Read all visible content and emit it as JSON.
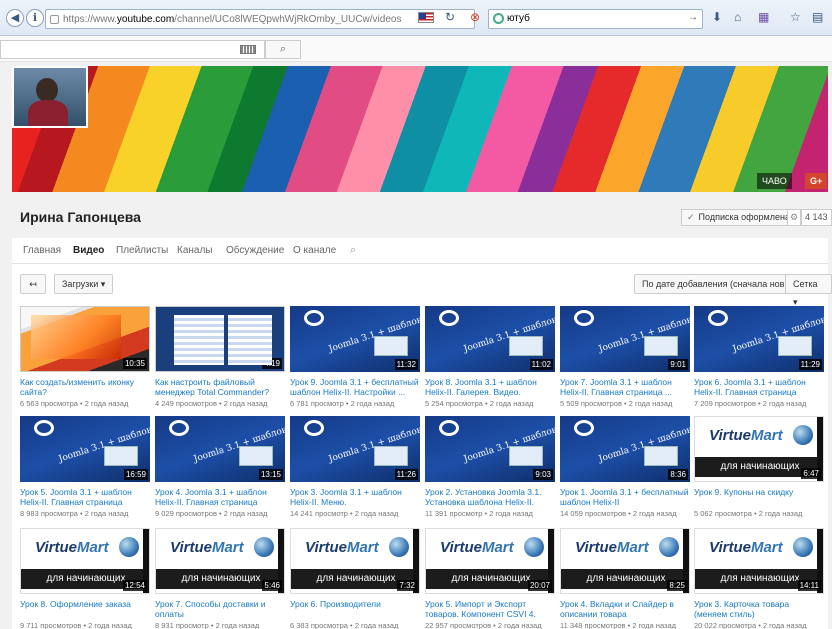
{
  "browser": {
    "url_prefix": "https://www.",
    "url_host": "youtube.com",
    "url_path": "/channel/UCo8lWEQpwhWjRkOmby_UUCw/videos",
    "search_query": "ютуб"
  },
  "channel": {
    "name": "Ирина Гапонцева",
    "subscribe_label": "Подписка оформлена",
    "subscriber_count": "4 143",
    "banner_links": [
      "ЧАВО",
      "G+"
    ]
  },
  "tabs": [
    "Главная",
    "Видео",
    "Плейлисты",
    "Каналы",
    "Обсуждение",
    "О канале"
  ],
  "active_tab": "Видео",
  "toolbar": {
    "uploads_label": "Загрузки ▾",
    "sort_label": "По дате добавления (сначала новые) ▾",
    "grid_label": "Сетка ▾"
  },
  "videos": [
    {
      "title": "Как создать/изменить иконку сайта?",
      "meta": "6 563 просмотра • 2 года назад",
      "duration": "10:35",
      "thumb": "screen1"
    },
    {
      "title": "Как настроить файловый менеджер Total Commander?",
      "meta": "4 249 просмотров • 2 года назад",
      "duration": "4:19",
      "thumb": "screen2"
    },
    {
      "title": "Урок 9. Joomla 3.1 + бесплатный шаблон Helix-II. Настройки ...",
      "meta": "6 781 просмотр • 2 года назад",
      "duration": "11:32",
      "thumb": "joomla"
    },
    {
      "title": "Урок 8. Joomla 3.1 + шаблон Helix-II. Галерея. Видео.",
      "meta": "5 254 просмотра • 2 года назад",
      "duration": "11:02",
      "thumb": "joomla"
    },
    {
      "title": "Урок 7. Joomla 3.1 + шаблон Helix-II. Главная страница ...",
      "meta": "5 509 просмотров • 2 года назад",
      "duration": "9:01",
      "thumb": "joomla"
    },
    {
      "title": "Урок 6. Joomla 3.1 + шаблон Helix-II. Главная страница",
      "meta": "7 209 просмотров • 2 года назад",
      "duration": "11:29",
      "thumb": "joomla"
    },
    {
      "title": "Урок 5. Joomla 3.1 + шаблон Helix-II. Главная страница",
      "meta": "8 983 просмотра • 2 года назад",
      "duration": "16:59",
      "thumb": "joomla"
    },
    {
      "title": "Урок 4. Joomla 3.1 + шаблон Helix-II. Главная страница",
      "meta": "9 029 просмотров • 2 года назад",
      "duration": "13:15",
      "thumb": "joomla"
    },
    {
      "title": "Урок 3. Joomla 3.1 + шаблон Helix-II. Меню.",
      "meta": "14 241 просмотр • 2 года назад",
      "duration": "11:26",
      "thumb": "joomla"
    },
    {
      "title": "Урок 2. Установка Joomla 3.1. Установка шаблона Helix-II.",
      "meta": "11 391 просмотр • 2 года назад",
      "duration": "9:03",
      "thumb": "joomla"
    },
    {
      "title": "Урок 1. Joomla 3.1 + бесплатный шаблон Helix-II",
      "meta": "14 059 просмотров • 2 года назад",
      "duration": "8:36",
      "thumb": "joomla"
    },
    {
      "title": "Урок 9. Купоны на скидку",
      "meta": "5 062 просмотра • 2 года назад",
      "duration": "6:47",
      "thumb": "vm"
    },
    {
      "title": "Урок 8. Оформление заказа",
      "meta": "9 711 просмотров • 2 года назад",
      "duration": "12:54",
      "thumb": "vm"
    },
    {
      "title": "Урок 7. Способы доставки и оплаты",
      "meta": "8 931 просмотр • 2 года назад",
      "duration": "5:46",
      "thumb": "vm"
    },
    {
      "title": "Урок 6. Производители",
      "meta": "6 383 просмотра • 2 года назад",
      "duration": "7:32",
      "thumb": "vm"
    },
    {
      "title": "Урок 5. Импорт и Экспорт товаров. Компонент CSVI 4.",
      "meta": "22 957 просмотров • 2 года назад",
      "duration": "20:07",
      "thumb": "vm"
    },
    {
      "title": "Урок 4. Вкладки и Слайдер в описании товара",
      "meta": "11 348 просмотров • 2 года назад",
      "duration": "8:25",
      "thumb": "vm"
    },
    {
      "title": "Урок 3. Карточка товара (меняем стиль)",
      "meta": "20 022 просмотра • 2 года назад",
      "duration": "14:11",
      "thumb": "vm"
    }
  ],
  "thumb_text": {
    "joomla_word": "Joomla 3.1 + шаблон Helix-II",
    "vm_brand_a": "Virtue",
    "vm_brand_b": "Mart",
    "vm_sub": "для начинающих"
  },
  "colors": {
    "link": "#167ac6",
    "accent": "#cc181e"
  }
}
